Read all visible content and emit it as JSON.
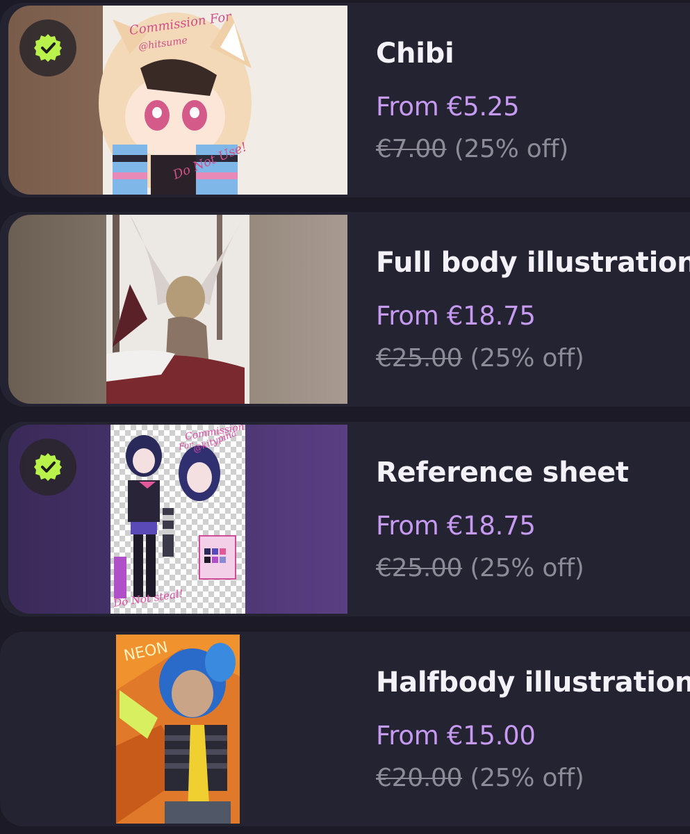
{
  "commissions": [
    {
      "title": "Chibi",
      "price": "From €5.25",
      "original_price": "€7.00",
      "discount": "(25% off)",
      "selected": true,
      "thumb_icon": "chibi-catgirl-artwork",
      "thumb_text": [
        "Commission For",
        "@hitsume",
        "Do Not Use!"
      ]
    },
    {
      "title": "Full body illustration",
      "price": "From €18.75",
      "original_price": "€25.00",
      "discount": "(25% off)",
      "selected": false,
      "thumb_icon": "winged-figure-artwork"
    },
    {
      "title": "Reference sheet",
      "price": "From €18.75",
      "original_price": "€25.00",
      "discount": "(25% off)",
      "selected": true,
      "thumb_icon": "reference-sheet-artwork",
      "thumb_text": [
        "Commission",
        "For",
        "@kitypina",
        "Do Not steal!"
      ]
    },
    {
      "title": "Halfbody illustration",
      "price": "From €15.00",
      "original_price": "€20.00",
      "discount": "(25% off)",
      "selected": false,
      "thumb_icon": "neon-halfbody-artwork",
      "thumb_text": [
        "NEON"
      ]
    }
  ],
  "colors": {
    "background": "#1b1a26",
    "card": "#242331",
    "title": "#f4f2f8",
    "price": "#c79af2",
    "original_price": "#8d8b97",
    "check_badge": "#b8f24a"
  }
}
